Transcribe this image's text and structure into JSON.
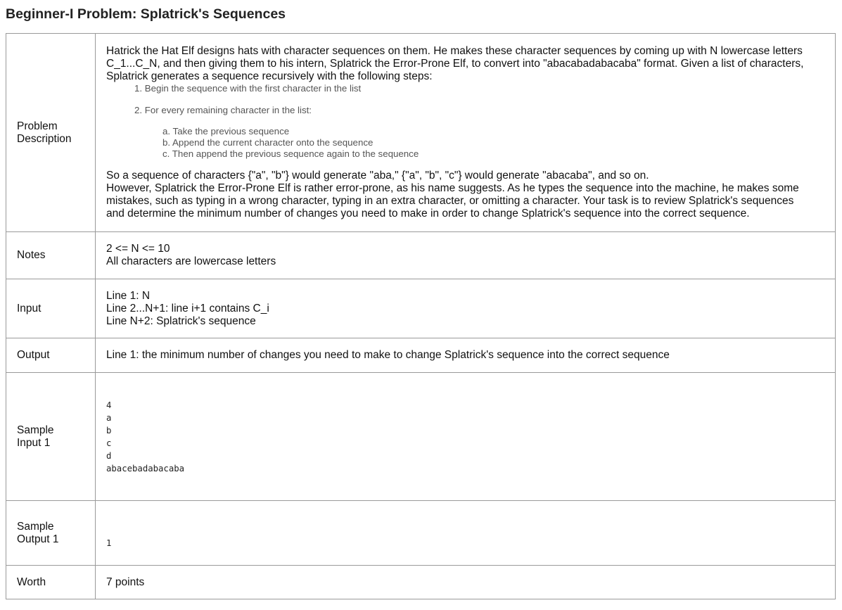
{
  "title": "Beginner-I Problem: Splatrick's Sequences",
  "description": {
    "label_line1": "Problem",
    "label_line2": "Description",
    "intro_1": "Hatrick the Hat Elf designs hats with character sequences on them. He makes these character sequences by coming up with N lowercase letters",
    "intro_2": "C_1...C_N, and then giving them to his intern, Splatrick the Error-Prone Elf, to convert into \"abacabadabacaba\" format. Given a list of characters,",
    "intro_3": "Splatrick generates a sequence recursively with the following steps:",
    "step_1": "1. Begin the sequence with the first character in the list",
    "step_2": "2. For every remaining character in the list:",
    "sub_a": "a. Take the previous sequence",
    "sub_b": "b. Append the current character onto the sequence",
    "sub_c": "c. Then append the previous sequence again to the sequence",
    "outro_1": "So a sequence of characters {\"a\", \"b\"} would generate \"aba,\" {\"a\", \"b\", \"c\"} would generate \"abacaba\", and so on.",
    "outro_2": "However, Splatrick the Error-Prone Elf is rather error-prone, as his name suggests. As he types the sequence into the machine, he makes some",
    "outro_3": "mistakes, such as typing in a wrong character, typing in an extra character, or omitting a character. Your task is to review Splatrick's sequences",
    "outro_4": "and determine the minimum number of changes you need to make in order to change Splatrick's sequence into the correct sequence."
  },
  "notes": {
    "label": "Notes",
    "line_1": "2 <= N <= 10",
    "line_2": "All characters are lowercase letters"
  },
  "input": {
    "label": "Input",
    "line_1": "Line 1: N",
    "line_2": "Line 2...N+1: line i+1 contains C_i",
    "line_3": "Line N+2: Splatrick's sequence"
  },
  "output": {
    "label": "Output",
    "line_1": "Line 1: the minimum number of changes you need to make to change Splatrick's sequence into the correct sequence"
  },
  "sample_input": {
    "label_line1": "Sample",
    "label_line2": "Input 1",
    "lines": [
      "4",
      "a",
      "b",
      "c",
      "d",
      "abacebadabacaba"
    ]
  },
  "sample_output": {
    "label_line1": "Sample",
    "label_line2": "Output 1",
    "line_1": "1"
  },
  "worth": {
    "label": "Worth",
    "value": "7 points"
  }
}
